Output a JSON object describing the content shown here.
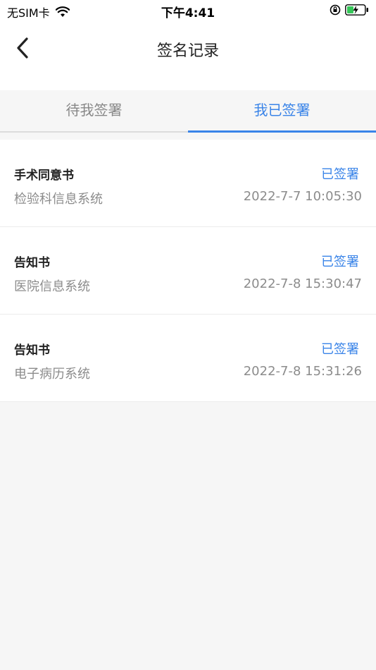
{
  "status_bar": {
    "carrier": "无SIM卡",
    "time": "下午4:41"
  },
  "nav": {
    "title": "签名记录"
  },
  "tabs": [
    {
      "label": "待我签署",
      "active": false
    },
    {
      "label": "我已签署",
      "active": true
    }
  ],
  "records": [
    {
      "title": "手术同意书",
      "status": "已签署",
      "system": "检验科信息系统",
      "time": "2022-7-7 10:05:30"
    },
    {
      "title": "告知书",
      "status": "已签署",
      "system": "医院信息系统",
      "time": "2022-7-8 15:30:47"
    },
    {
      "title": "告知书",
      "status": "已签署",
      "system": "电子病历系统",
      "time": "2022-7-8 15:31:26"
    }
  ],
  "colors": {
    "accent": "#3a84e8",
    "background": "#f6f6f6",
    "secondary_text": "#8c8c8c"
  },
  "icons": {
    "wifi": "wifi-icon",
    "rotation_lock": "rotation-lock-icon",
    "battery": "battery-charging-icon",
    "back": "chevron-left-icon"
  }
}
